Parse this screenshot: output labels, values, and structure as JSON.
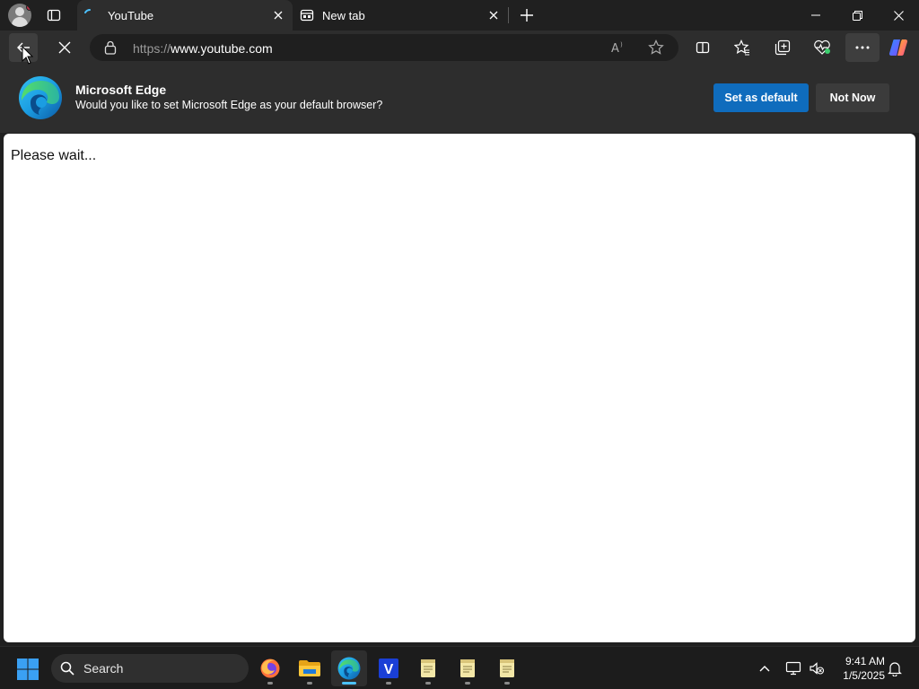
{
  "browser": {
    "tabs": [
      {
        "title": "YouTube",
        "active": true
      },
      {
        "title": "New tab",
        "active": false
      }
    ],
    "address": {
      "scheme": "https://",
      "host": "www.youtube.com"
    }
  },
  "infobar": {
    "title": "Microsoft Edge",
    "message": "Would you like to set Microsoft Edge as your default browser?",
    "primary_label": "Set as default",
    "secondary_label": "Not Now"
  },
  "page": {
    "message": "Please wait..."
  },
  "taskbar": {
    "search_label": "Search",
    "apps": [
      "firefox-icon",
      "file-explorer-icon",
      "edge-icon",
      "v-app-icon",
      "notepad-icon",
      "notepad-icon",
      "notepad-icon"
    ],
    "time": "9:41 AM",
    "date": "1/5/2025"
  },
  "colors": {
    "accent": "#0f6cbd",
    "chrome_bg": "#202020",
    "toolbar_bg": "#2d2d2d"
  }
}
